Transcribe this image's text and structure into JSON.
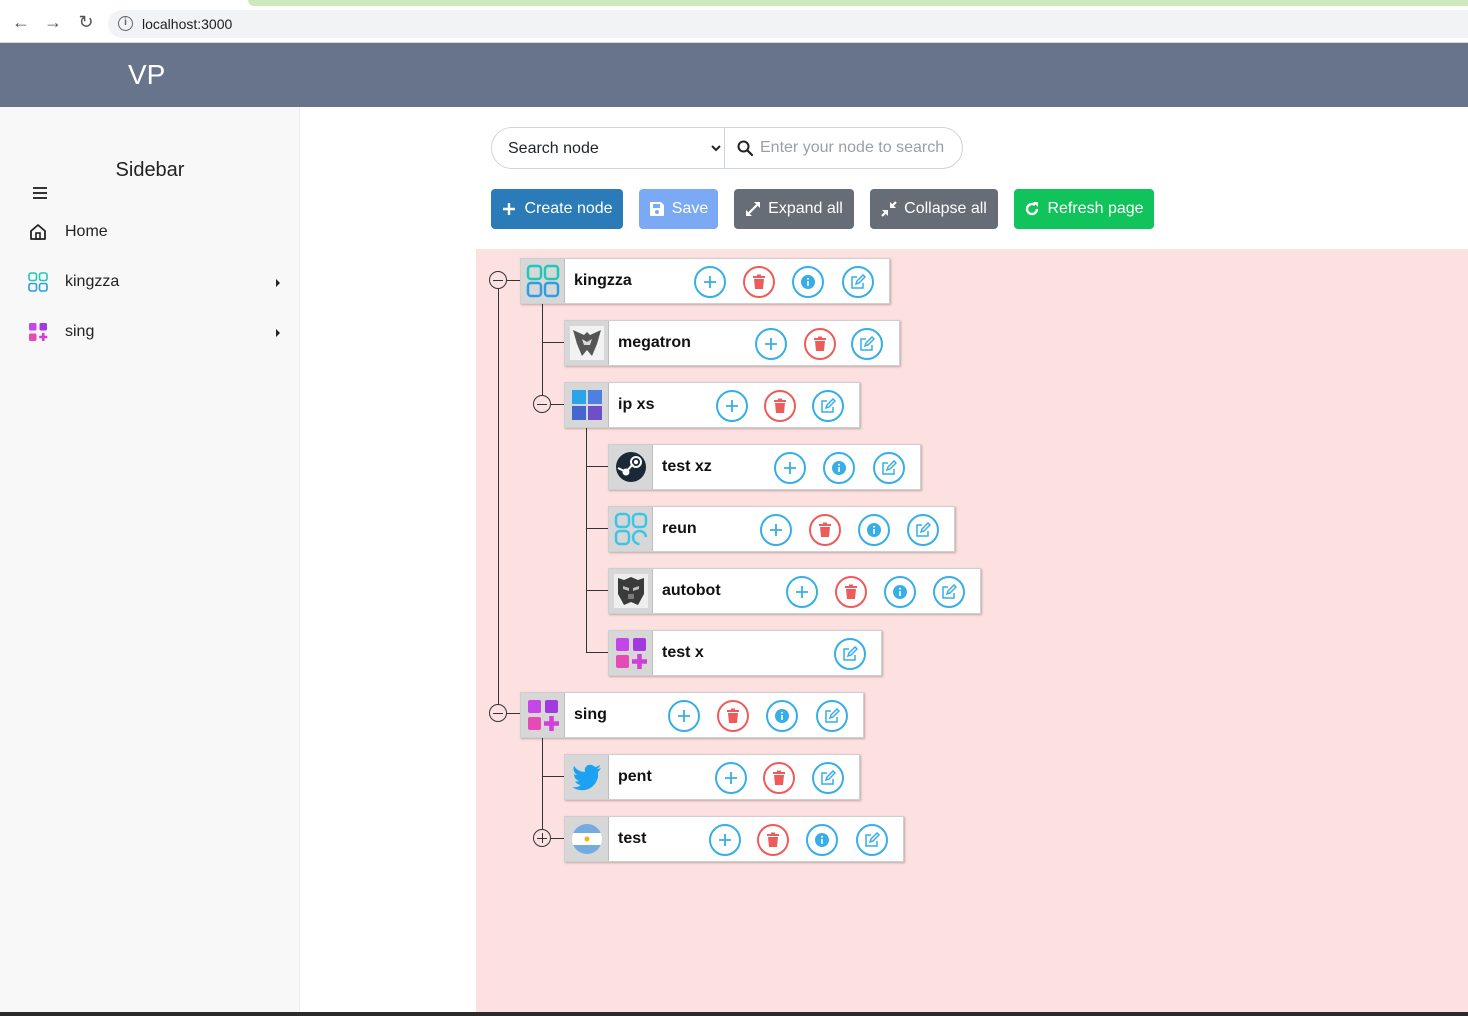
{
  "browser": {
    "url": "localhost:3000"
  },
  "header": {
    "brand": "VP"
  },
  "sidebar": {
    "title": "Sidebar",
    "items": [
      {
        "label": "Home",
        "icon": "home-icon"
      },
      {
        "label": "kingzza",
        "icon": "grid-icon"
      },
      {
        "label": "sing",
        "icon": "grid-plus-icon"
      }
    ]
  },
  "search": {
    "select_value": "Search node",
    "placeholder": "Enter your node to search"
  },
  "toolbar": {
    "create": "Create node",
    "save": "Save",
    "expand": "Expand all",
    "collapse": "Collapse all",
    "refresh": "Refresh page"
  },
  "tree": {
    "nodes": [
      {
        "label": "kingzza",
        "icon": "grid-icon",
        "actions": [
          "add",
          "delete",
          "info",
          "edit"
        ]
      },
      {
        "label": "megatron",
        "icon": "decepticon-icon",
        "actions": [
          "add",
          "delete",
          "edit"
        ]
      },
      {
        "label": "ip xs",
        "icon": "windows-icon",
        "actions": [
          "add",
          "delete",
          "edit"
        ]
      },
      {
        "label": "test xz",
        "icon": "steam-icon",
        "actions": [
          "add",
          "info",
          "edit"
        ]
      },
      {
        "label": "reun",
        "icon": "grid-outline-icon",
        "actions": [
          "add",
          "delete",
          "info",
          "edit"
        ]
      },
      {
        "label": "autobot",
        "icon": "autobot-icon",
        "actions": [
          "add",
          "delete",
          "info",
          "edit"
        ]
      },
      {
        "label": "test x",
        "icon": "grid-plus-icon",
        "actions": [
          "edit"
        ]
      },
      {
        "label": "sing",
        "icon": "grid-plus-icon",
        "actions": [
          "add",
          "delete",
          "info",
          "edit"
        ]
      },
      {
        "label": "pent",
        "icon": "twitter-icon",
        "actions": [
          "add",
          "delete",
          "edit"
        ]
      },
      {
        "label": "test",
        "icon": "argentina-flag-icon",
        "actions": [
          "add",
          "delete",
          "info",
          "edit"
        ]
      }
    ]
  },
  "colors": {
    "header": "#68748c",
    "tree_background": "#fde0e0",
    "action_blue": "#37aee6",
    "action_red": "#ef5b5b",
    "create_button": "#2b7bb9",
    "save_button": "#7ba9f3",
    "expand_button": "#676d76",
    "refresh_button": "#10c35a"
  }
}
